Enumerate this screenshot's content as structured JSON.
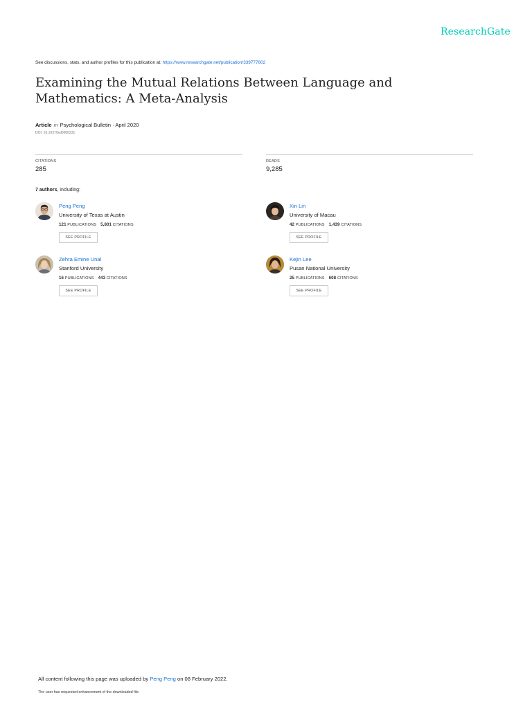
{
  "brand": "ResearchGate",
  "header": {
    "discuss_text": "See discussions, stats, and author profiles for this publication at:",
    "url": "https://www.researchgate.net/publication/339777602"
  },
  "publication": {
    "title": "Examining the Mutual Relations Between Language and Mathematics: A Meta-Analysis",
    "type": "Article",
    "in_word": "in",
    "journal": "Psychological Bulletin · April 2020",
    "doi": "DOI: 10.1037/bul0000231"
  },
  "stats": {
    "citations_label": "CITATIONS",
    "citations_value": "285",
    "reads_label": "READS",
    "reads_value": "9,285"
  },
  "authors_heading": {
    "count": "7 authors",
    "suffix": ", including:"
  },
  "authors": [
    {
      "name": "Peng Peng",
      "institution": "University of Texas at Austin",
      "publications": "121",
      "citations": "5,801"
    },
    {
      "name": "Xin Lin",
      "institution": "University of Macau",
      "publications": "42",
      "citations": "1,439"
    },
    {
      "name": "Zehra Emine Unal",
      "institution": "Stanford University",
      "publications": "16",
      "citations": "443"
    },
    {
      "name": "Kejin Lee",
      "institution": "Pusan National University",
      "publications": "25",
      "citations": "608"
    }
  ],
  "labels": {
    "publications": "PUBLICATIONS",
    "citations": "CITATIONS",
    "see_profile": "SEE PROFILE"
  },
  "footer": {
    "uploaded_prefix": "All content following this page was uploaded by",
    "uploader": "Peng Peng",
    "uploaded_suffix": "on 08 February 2022.",
    "note": "The user has requested enhancement of the downloaded file."
  }
}
